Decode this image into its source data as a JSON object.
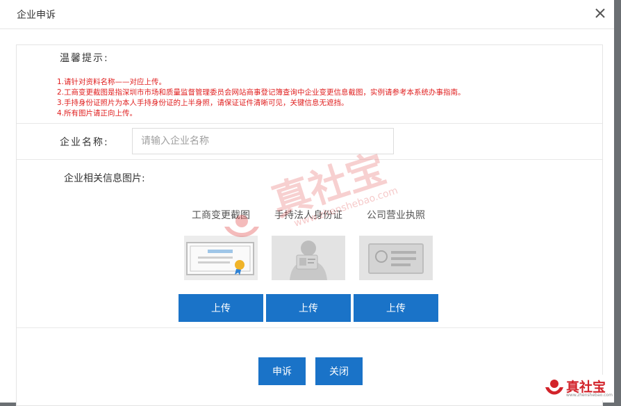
{
  "dialog": {
    "title": "企业申诉",
    "close_icon": "close-icon"
  },
  "tips": {
    "title": "温馨提示:",
    "lines": [
      "1.请针对资料名称——对应上传。",
      "2.工商变更截图是指深圳市市场和质量监督管理委员会网站商事登记簿查询中企业变更信息截图，实例请参考本系统办事指南。",
      "3.手持身份证照片为本人手持身份证的上半身照，请保证证件清晰可见，关键信息无遮挡。",
      "4.所有图片请正向上传。"
    ],
    "color": "#e02020"
  },
  "company": {
    "label": "企业名称:",
    "placeholder": "请输入企业名称",
    "value": ""
  },
  "images": {
    "label": "企业相关信息图片:",
    "items": [
      {
        "caption": "工商变更截图",
        "upload_label": "上传",
        "icon": "certificate-icon"
      },
      {
        "caption": "手持法人身份证",
        "upload_label": "上传",
        "icon": "person-holding-id-icon"
      },
      {
        "caption": "公司营业执照",
        "upload_label": "上传",
        "icon": "business-license-icon"
      }
    ]
  },
  "actions": {
    "submit_label": "申诉",
    "close_label": "关闭"
  },
  "watermark": {
    "text": "真社宝",
    "url": "www.zhenshebao.com"
  },
  "corner_logo": {
    "text": "真社宝",
    "url": "www.zhenshebao.com"
  },
  "colors": {
    "primary": "#1a73c8",
    "warning_text": "#e02020",
    "brand_red": "#d2232a"
  }
}
